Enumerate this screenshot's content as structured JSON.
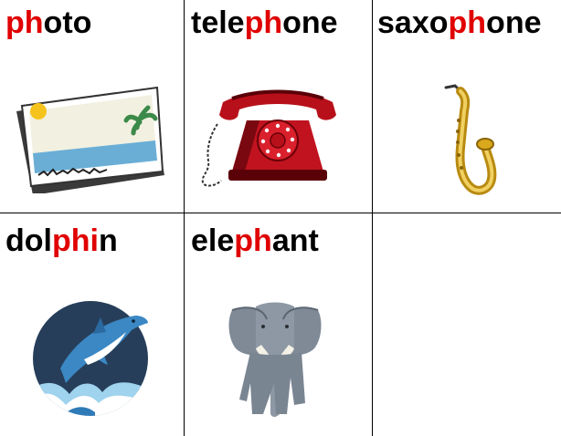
{
  "cards": [
    {
      "word": {
        "pre": "",
        "ph": "ph",
        "post": "oto"
      },
      "picture": "photo-icon"
    },
    {
      "word": {
        "pre": "tele",
        "ph": "ph",
        "post": "one"
      },
      "picture": "telephone-icon"
    },
    {
      "word": {
        "pre": "saxo",
        "ph": "ph",
        "post": "one"
      },
      "picture": "saxophone-icon"
    },
    {
      "word": {
        "pre": "dol",
        "ph": "phi",
        "post": "n"
      },
      "picture": "dolphin-icon"
    },
    {
      "word": {
        "pre": "ele",
        "ph": "ph",
        "post": "ant"
      },
      "picture": "elephant-icon"
    }
  ],
  "colors": {
    "highlight": "#e00000",
    "text": "#000000",
    "grid": "#000000"
  }
}
